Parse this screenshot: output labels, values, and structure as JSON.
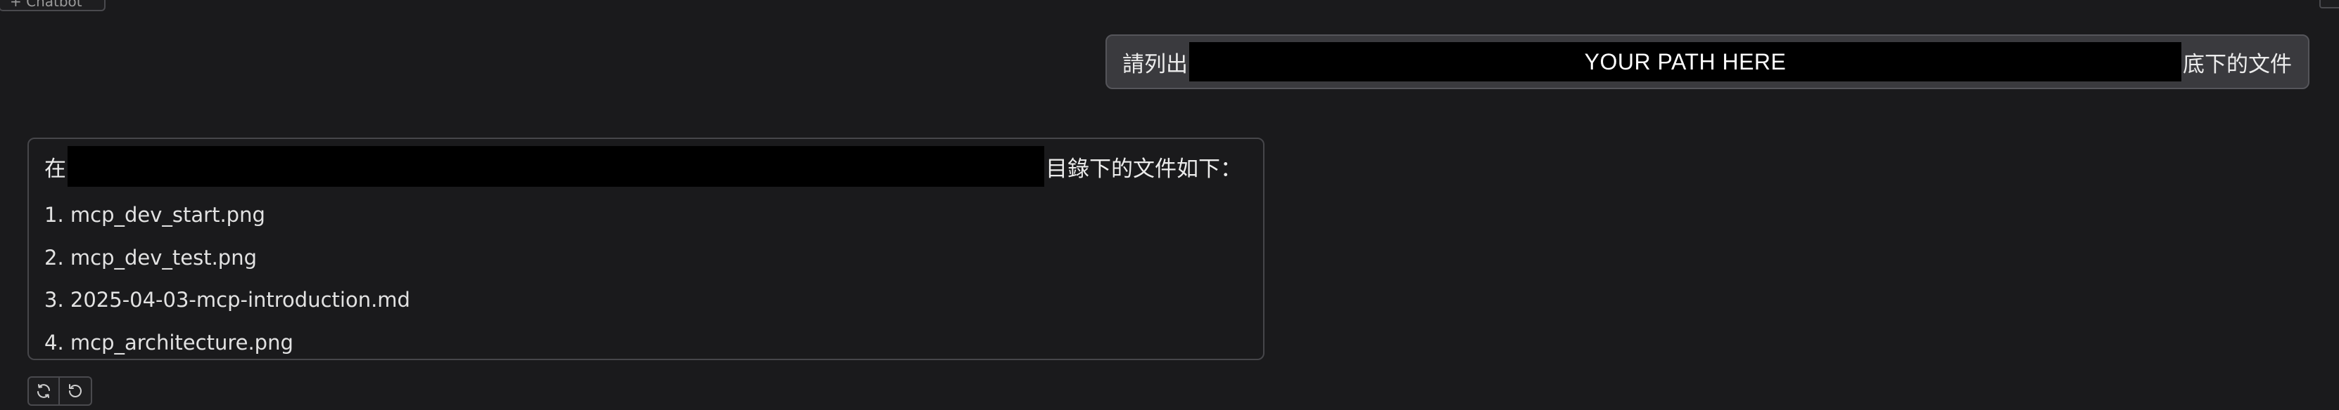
{
  "header": {
    "left_chip_label": "+ Chatbot"
  },
  "user_message": {
    "prefix": "請列出",
    "path_placeholder": "YOUR PATH HERE",
    "suffix": "底下的文件"
  },
  "assistant_message": {
    "prefix": "在",
    "suffix": "目錄下的文件如下：",
    "files": [
      "1. mcp_dev_start.png",
      "2. mcp_dev_test.png",
      "3. 2025-04-03-mcp-introduction.md",
      "4. mcp_architecture.png"
    ]
  },
  "actions": {
    "retry_icon": "refresh-icon",
    "undo_icon": "undo-icon"
  },
  "colors": {
    "background": "#1a1a1c",
    "user_bubble": "#3a3a3e",
    "redaction": "#000000",
    "text": "#ececec"
  }
}
